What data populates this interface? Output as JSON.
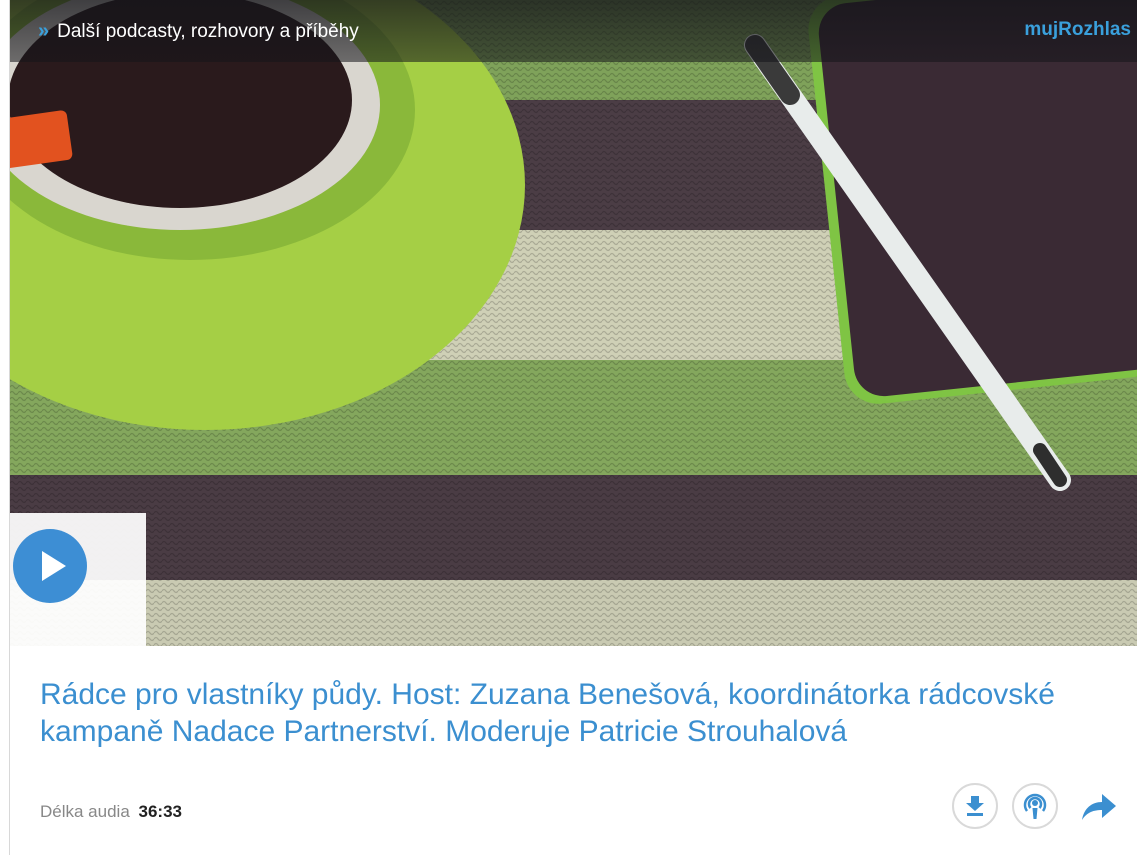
{
  "header": {
    "more_link_icon": "double-chevron-right-icon",
    "more_link_label": "Další podcasty, rozhovory a příběhy",
    "brand_label": "mujRozhlas"
  },
  "player": {
    "play_icon": "play-icon"
  },
  "episode": {
    "title": "Rádce pro vlastníky půdy. Host: Zuzana Benešová, koordinátorka rádcovské kampaně Nadace Partnerství. Moderuje Patricie Strouhalová",
    "duration_label": "Délka audia",
    "duration_value": "36:33"
  },
  "actions": {
    "download_icon": "download-icon",
    "podcast_icon": "podcast-icon",
    "share_icon": "share-icon"
  },
  "colors": {
    "accent": "#3b8fd0",
    "play": "#3d8ed4",
    "stripe_green": "#7fa25a",
    "stripe_purple": "#4b3d45",
    "stripe_cream": "#cfd0b6"
  }
}
